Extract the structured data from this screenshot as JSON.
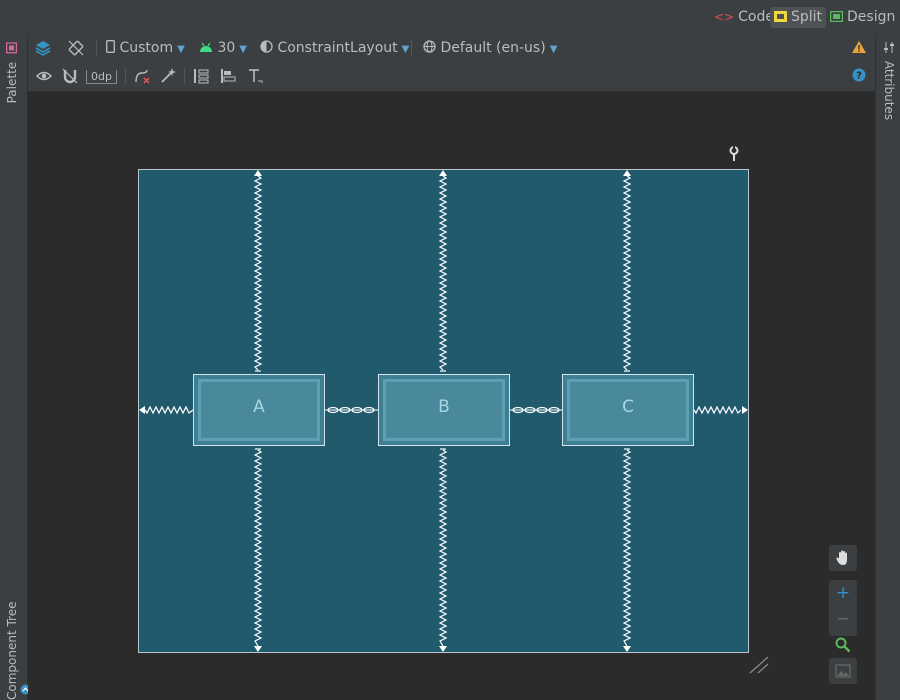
{
  "modes": {
    "code_label": "Code",
    "split_label": "Split",
    "design_label": "Design"
  },
  "side_tabs": {
    "palette": "Palette",
    "component_tree": "Component Tree",
    "attributes": "Attributes"
  },
  "toolbar": {
    "device": "Custom",
    "api_level": "30",
    "layout_type": "ConstraintLayout",
    "locale": "Default (en-us)",
    "default_margin": "0dp"
  },
  "widgets": [
    {
      "label": "A"
    },
    {
      "label": "B"
    },
    {
      "label": "C"
    }
  ],
  "colors": {
    "blueprint": "#215a6d",
    "android_green": "#3ddc84",
    "warning": "#e8a33d",
    "code_red": "#d9534f",
    "split_yellow": "#f2d640",
    "design_green": "#5bb85c",
    "info_blue": "#3592c4"
  }
}
